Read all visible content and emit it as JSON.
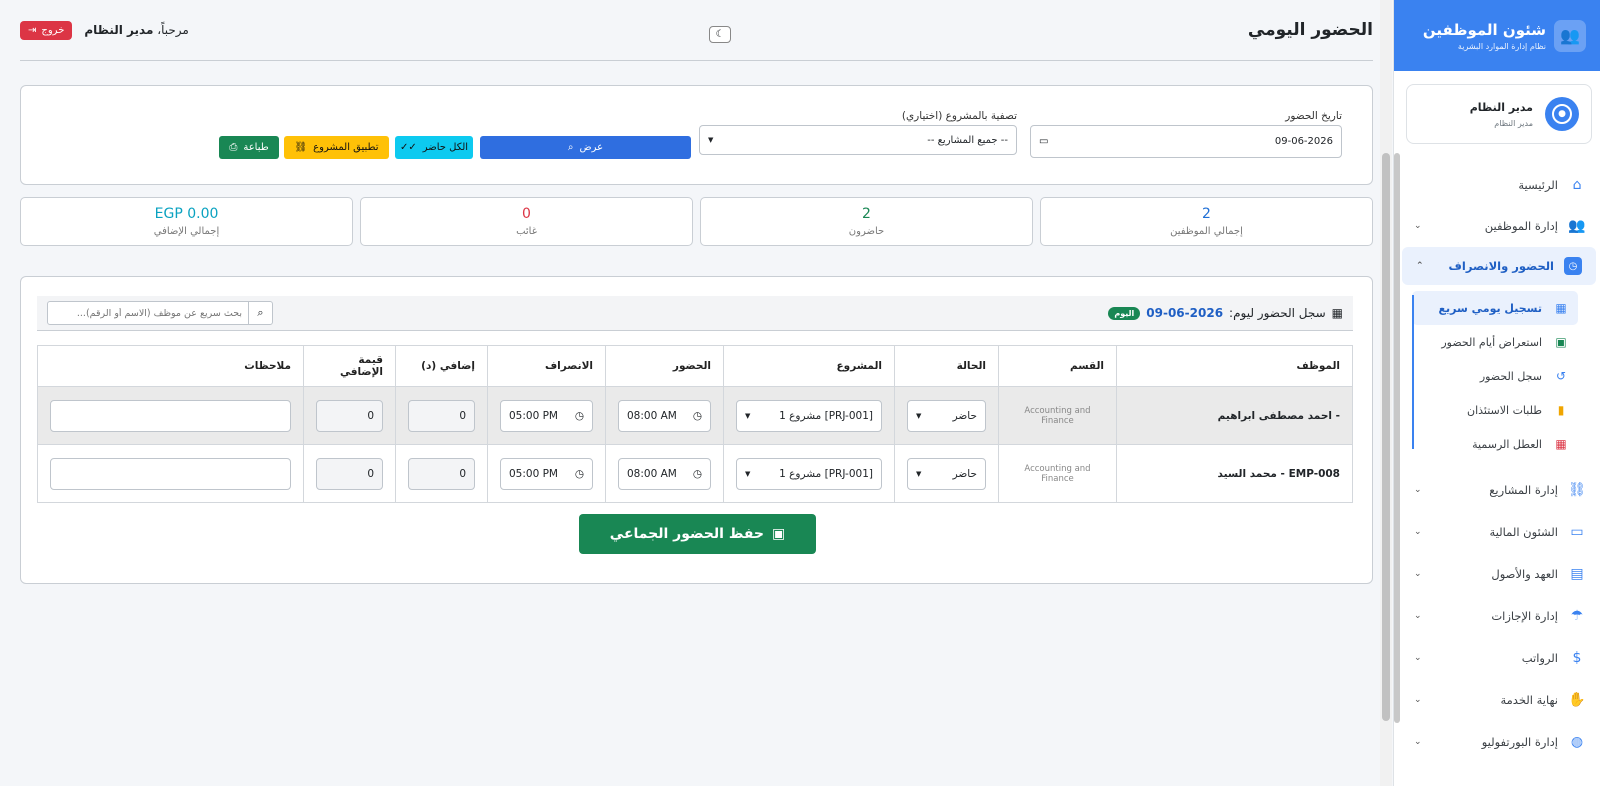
{
  "sidebar": {
    "brand_title": "شئون الموظفين",
    "brand_sub": "نظام إدارة الموارد البشرية",
    "user_name": "مدير النظام",
    "user_role": "مدير النظام",
    "menu": {
      "home": "الرئيسية",
      "employees": "إدارة الموظفين",
      "attendance": "الحضور والانصراف",
      "projects": "إدارة المشاريع",
      "finance": "الشئون المالية",
      "assets": "العهد والأصول",
      "leaves": "إدارة الإجازات",
      "salaries": "الرواتب",
      "end_service": "نهاية الخدمة",
      "portfolio": "إدارة البورتفوليو"
    },
    "submenu": {
      "quick": "تسجيل يومي سريع",
      "review": "استعراض أيام الحضور",
      "log": "سجل الحضور",
      "permissions": "طلبات الاستئذان",
      "holidays": "العطل الرسمية"
    }
  },
  "header": {
    "title": "الحضور اليومي",
    "welcome": "مرحباً،",
    "user": "مدير النظام",
    "logout": "خروج"
  },
  "filter": {
    "date_label": "تاريخ الحضور",
    "date_value": "09-06-2026",
    "project_label": "تصفية بالمشروع (اختياري)",
    "project_value": "-- جميع المشاريع --",
    "show_btn": "عرض",
    "all_present_btn": "الكل حاضر",
    "apply_project_btn": "تطبيق المشروع",
    "print_btn": "طباعة"
  },
  "stats": {
    "total_value": "2",
    "total_label": "إجمالي الموظفين",
    "present_value": "2",
    "present_label": "حاضرون",
    "absent_value": "0",
    "absent_label": "غائب",
    "overtime_value": "EGP 0.00",
    "overtime_label": "إجمالي الإضافي",
    "colors": {
      "total": "#1f6fd6",
      "present": "#198754",
      "absent": "#dc3545",
      "overtime": "#0aa2c0"
    }
  },
  "table": {
    "title": "سجل الحضور ليوم:",
    "date": "09-06-2026",
    "today_badge": "اليوم",
    "search_placeholder": "بحث سريع عن موظف (الاسم أو الرقم)...",
    "columns": [
      "الموظف",
      "القسم",
      "الحالة",
      "المشروع",
      "الحضور",
      "الانصراف",
      "إضافي (د)",
      "قيمة الإضافي",
      "ملاحظات"
    ],
    "rows": [
      {
        "employee": "- احمد مصطفى ابراهيم",
        "dept": "Accounting and Finance",
        "status": "حاضر",
        "project": "[PRJ-001] مشروع 1",
        "in": "08:00 AM",
        "out": "05:00 PM",
        "ot": "0",
        "ot_value": "0",
        "notes": ""
      },
      {
        "employee": "EMP-008 - محمد السيد",
        "dept": "Accounting and Finance",
        "status": "حاضر",
        "project": "[PRJ-001] مشروع 1",
        "in": "08:00 AM",
        "out": "05:00 PM",
        "ot": "0",
        "ot_value": "0",
        "notes": ""
      }
    ],
    "save_btn": "حفظ الحضور الجماعي"
  }
}
